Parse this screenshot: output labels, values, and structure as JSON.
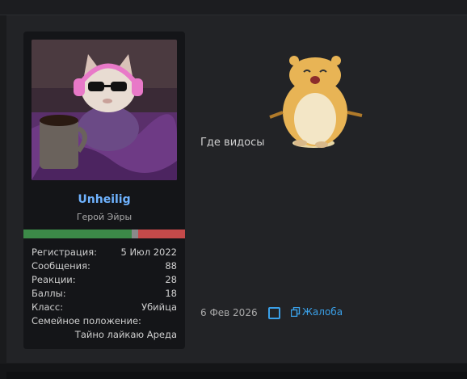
{
  "user": {
    "name": "Unheilig",
    "title": "Герой Эйры",
    "reputation": {
      "positive_fraction": 0.67,
      "neutral_fraction": 0.04,
      "negative_fraction": 0.29
    }
  },
  "stats": [
    {
      "label": "Регистрация:",
      "value": "5 Июл 2022"
    },
    {
      "label": "Сообщения:",
      "value": "88"
    },
    {
      "label": "Реакции:",
      "value": "28"
    },
    {
      "label": "Баллы:",
      "value": "18"
    },
    {
      "label": "Класс:",
      "value": "Убийца"
    }
  ],
  "family": {
    "label": "Семейное положение:",
    "value": "Тайно лайкаю Ареда"
  },
  "message": {
    "text": "Где видосы",
    "sticker_icon": "hamster-sticker-icon"
  },
  "footer": {
    "date": "6 Фев 2026",
    "report_label": "Жалоба"
  },
  "colors": {
    "accent": "#3aa0e8",
    "username": "#6fb3ff",
    "rep_positive": "#3c8a48",
    "rep_negative": "#c54a4a"
  }
}
